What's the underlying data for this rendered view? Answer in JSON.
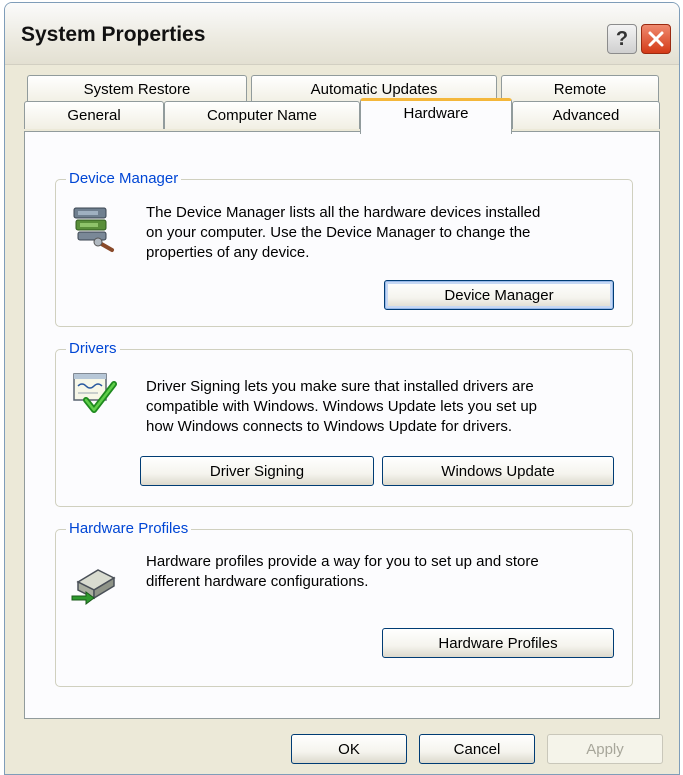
{
  "window": {
    "title": "System Properties",
    "help_glyph": "?"
  },
  "tabs": {
    "row1": [
      "System Restore",
      "Automatic Updates",
      "Remote"
    ],
    "row2": [
      "General",
      "Computer Name",
      "Hardware",
      "Advanced"
    ],
    "active": "Hardware"
  },
  "device_manager": {
    "label": "Device Manager",
    "description": [
      "The Device Manager lists all the hardware devices installed",
      "on your computer. Use the Device Manager to change the",
      "properties of any device."
    ],
    "button": "Device Manager",
    "icon": "device-manager-icon"
  },
  "drivers": {
    "label": "Drivers",
    "description": [
      "Driver Signing lets you make sure that installed drivers are",
      "compatible with Windows. Windows Update lets you set up",
      "how Windows connects to Windows Update for drivers."
    ],
    "signing_button": "Driver Signing",
    "update_button": "Windows Update",
    "icon": "driver-signing-icon"
  },
  "hardware_profiles": {
    "label": "Hardware Profiles",
    "description": [
      "Hardware profiles provide a way for you to set up and store",
      "different hardware configurations."
    ],
    "button": "Hardware Profiles",
    "icon": "hardware-profiles-icon"
  },
  "footer": {
    "ok": "OK",
    "cancel": "Cancel",
    "apply": "Apply"
  },
  "colors": {
    "group_label": "#0046d5",
    "active_tab_accent": "#f4b73b",
    "close_button": "#d43a17"
  }
}
